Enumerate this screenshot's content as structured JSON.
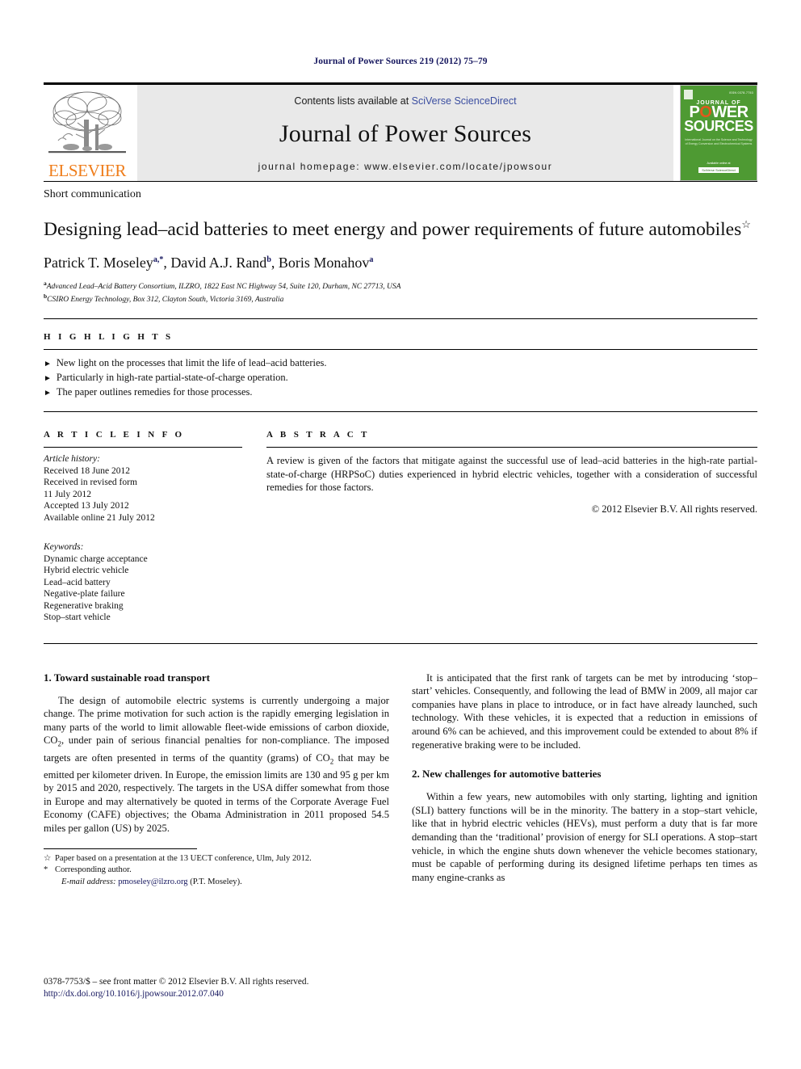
{
  "running_head": "Journal of Power Sources 219 (2012) 75–79",
  "masthead": {
    "contents_prefix": "Contents lists available at ",
    "sciencedirect": "SciVerse ScienceDirect",
    "journal_title": "Journal of Power Sources",
    "homepage": "journal homepage: www.elsevier.com/locate/jpowsour",
    "publisher_name": "ELSEVIER",
    "cover": {
      "issn_line": "ISSN 0378-7753",
      "kicker": "JOURNAL OF",
      "word_power": "POWER",
      "word_sources": "SOURCES",
      "subtitle": "International Journal on the Science and Technology of Energy Conversion and Electrochemical Systems",
      "footer_note": "Available online at",
      "footer_box": "SciVerse ScienceDirect"
    },
    "accent_orange": "#ef7d1a",
    "cover_green": "#4e9a33",
    "link_blue": "#3b4ea0"
  },
  "article": {
    "type": "Short communication",
    "title": "Designing lead–acid batteries to meet energy and power requirements of future automobiles",
    "title_marker": "☆",
    "authors": [
      {
        "name": "Patrick T. Moseley",
        "marks": "a,*"
      },
      {
        "name": "David A.J. Rand",
        "marks": "b"
      },
      {
        "name": "Boris Monahov",
        "marks": "a"
      }
    ],
    "affiliations": [
      {
        "mark": "a",
        "text": "Advanced Lead–Acid Battery Consortium, ILZRO, 1822 East NC Highway 54, Suite 120, Durham, NC 27713, USA"
      },
      {
        "mark": "b",
        "text": "CSIRO Energy Technology, Box 312, Clayton South, Victoria 3169, Australia"
      }
    ]
  },
  "highlights": {
    "heading": "H I G H L I G H T S",
    "items": [
      "New light on the processes that limit the life of lead–acid batteries.",
      "Particularly in high-rate partial-state-of-charge operation.",
      "The paper outlines remedies for those processes."
    ]
  },
  "article_info": {
    "heading": "A R T I C L E   I N F O",
    "history_label": "Article history:",
    "history": [
      "Received 18 June 2012",
      "Received in revised form",
      "11 July 2012",
      "Accepted 13 July 2012",
      "Available online 21 July 2012"
    ],
    "keywords_label": "Keywords:",
    "keywords": [
      "Dynamic charge acceptance",
      "Hybrid electric vehicle",
      "Lead–acid battery",
      "Negative-plate failure",
      "Regenerative braking",
      "Stop–start vehicle"
    ]
  },
  "abstract": {
    "heading": "A B S T R A C T",
    "text": "A review is given of the factors that mitigate against the successful use of lead–acid batteries in the high-rate partial-state-of-charge (HRPSoC) duties experienced in hybrid electric vehicles, together with a consideration of successful remedies for those factors.",
    "copyright": "© 2012 Elsevier B.V. All rights reserved."
  },
  "body": {
    "section1_heading": "1. Toward sustainable road transport",
    "section1_para1": "The design of automobile electric systems is currently undergoing a major change. The prime motivation for such action is the rapidly emerging legislation in many parts of the world to limit allowable fleet-wide emissions of carbon dioxide, CO₂, under pain of serious financial penalties for non-compliance. The imposed targets are often presented in terms of the quantity (grams) of CO₂ that may be emitted per kilometer driven. In Europe, the emission limits are 130 and 95 g per km by 2015 and 2020, respectively. The targets in the USA differ somewhat from those in Europe and may alternatively be quoted in terms of the Corporate Average Fuel Economy (CAFE) objectives; the Obama Administration in 2011 proposed 54.5 miles per gallon (US) by 2025.",
    "right_para1": "It is anticipated that the first rank of targets can be met by introducing ‘stop–start’ vehicles. Consequently, and following the lead of BMW in 2009, all major car companies have plans in place to introduce, or in fact have already launched, such technology. With these vehicles, it is expected that a reduction in emissions of around 6% can be achieved, and this improvement could be extended to about 8% if regenerative braking were to be included.",
    "section2_heading": "2. New challenges for automotive batteries",
    "section2_para1": "Within a few years, new automobiles with only starting, lighting and ignition (SLI) battery functions will be in the minority. The battery in a stop–start vehicle, like that in hybrid electric vehicles (HEVs), must perform a duty that is far more demanding than the ‘traditional’ provision of energy for SLI operations. A stop–start vehicle, in which the engine shuts down whenever the vehicle becomes stationary, must be capable of performing during its designed lifetime perhaps ten times as many engine-cranks as"
  },
  "footnotes": [
    {
      "mark": "☆",
      "text": "Paper based on a presentation at the 13 UECT conference, Ulm, July 2012."
    },
    {
      "mark": "*",
      "text": "Corresponding author."
    }
  ],
  "email_note": {
    "label": "E-mail address:",
    "address": "pmoseley@ilzro.org",
    "owner": "(P.T. Moseley)."
  },
  "page_footer": {
    "line1": "0378-7753/$ – see front matter © 2012 Elsevier B.V. All rights reserved.",
    "doi": "http://dx.doi.org/10.1016/j.jpowsour.2012.07.040"
  }
}
